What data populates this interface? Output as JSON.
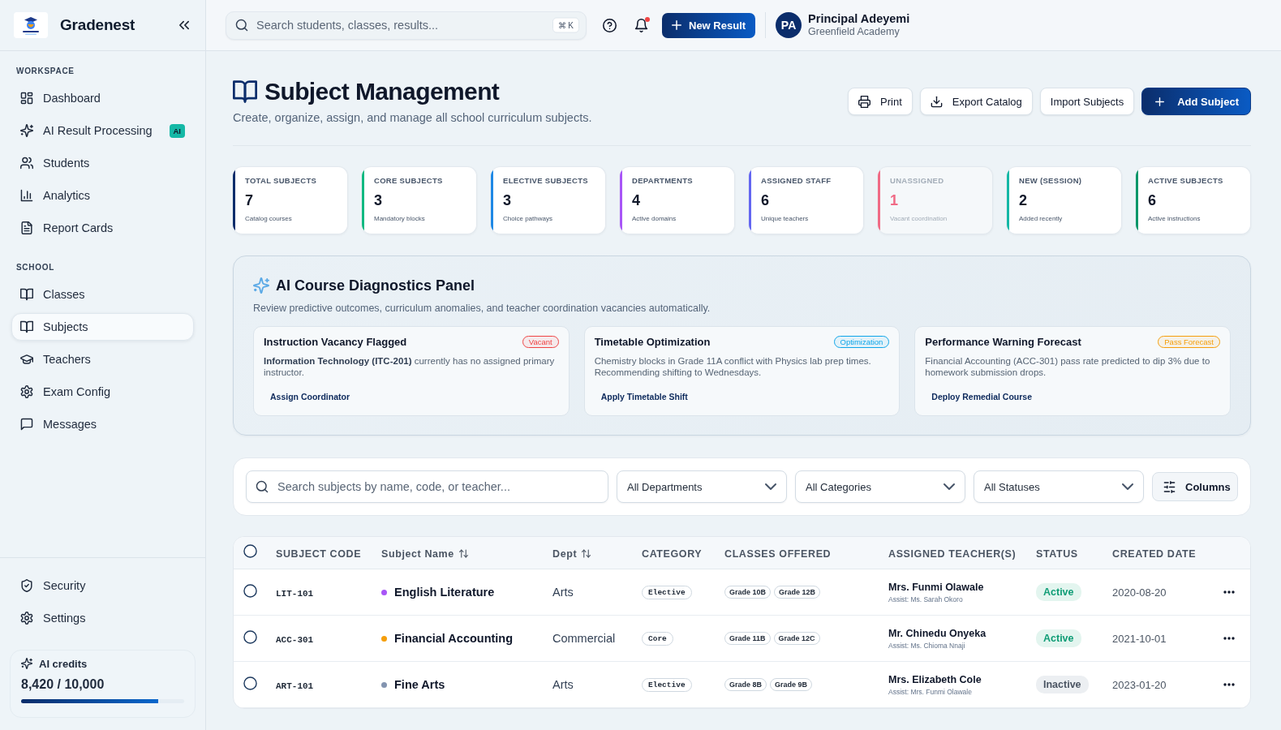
{
  "sidebar": {
    "brand": "Gradenest",
    "sections": [
      {
        "title": "WORKSPACE",
        "items": [
          {
            "label": "Dashboard",
            "selected": false
          },
          {
            "label": "AI Result Processing",
            "selected": false,
            "badge": "AI"
          },
          {
            "label": "Students",
            "selected": false
          },
          {
            "label": "Analytics",
            "selected": false
          },
          {
            "label": "Report Cards",
            "selected": false
          }
        ]
      },
      {
        "title": "SCHOOL",
        "items": [
          {
            "label": "Classes",
            "selected": false
          },
          {
            "label": "Subjects",
            "selected": true
          },
          {
            "label": "Teachers",
            "selected": false
          },
          {
            "label": "Exam Config",
            "selected": false
          },
          {
            "label": "Messages",
            "selected": false
          }
        ]
      }
    ],
    "footer_items": [
      {
        "label": "Security",
        "selected": false
      },
      {
        "label": "Settings",
        "selected": false
      }
    ],
    "credits": {
      "label": "AI credits",
      "value": "8,420 / 10,000",
      "level": 0.842
    }
  },
  "topbar": {
    "search": {
      "placeholder": "Search students, classes, results..."
    },
    "shortcut": "⌘ K",
    "notifications_unread": true,
    "new_button": "New Result",
    "user": {
      "initials": "PA",
      "name": "Principal Adeyemi",
      "school": "Greenfield Academy"
    }
  },
  "page": {
    "title": "Subject Management",
    "subtitle": "Create, organize, assign, and manage all school curriculum subjects.",
    "actions": [
      {
        "label": "Print",
        "kind": "print"
      },
      {
        "label": "Export Catalog",
        "kind": "export"
      },
      {
        "label": "Import Subjects",
        "kind": "import"
      },
      {
        "label": "Add Subject",
        "kind": "add"
      }
    ]
  },
  "stats": [
    {
      "label": "TOTAL SUBJECTS",
      "value": "7",
      "note": "Catalog courses",
      "color": "#0b2d6b",
      "muted": false
    },
    {
      "label": "CORE SUBJECTS",
      "value": "3",
      "note": "Mandatory blocks",
      "color": "#10b981",
      "muted": false
    },
    {
      "label": "ELECTIVE SUBJECTS",
      "value": "3",
      "note": "Choice pathways",
      "color": "#1e88e5",
      "muted": false
    },
    {
      "label": "DEPARTMENTS",
      "value": "4",
      "note": "Active domains",
      "color": "#a855f7",
      "muted": false
    },
    {
      "label": "ASSIGNED STAFF",
      "value": "6",
      "note": "Unique teachers",
      "color": "#6366f1",
      "muted": false
    },
    {
      "label": "UNASSIGNED",
      "value": "1",
      "note": "Vacant coordination",
      "color": "#f06a85",
      "muted": true
    },
    {
      "label": "NEW (SESSION)",
      "value": "2",
      "note": "Added recently",
      "color": "#14b8a6",
      "muted": false
    },
    {
      "label": "ACTIVE SUBJECTS",
      "value": "6",
      "note": "Active instructions",
      "color": "#059669",
      "muted": false
    }
  ],
  "ai_panel": {
    "title": "AI Course Diagnostics Panel",
    "description": "Review predictive outcomes, curriculum anomalies, and teacher coordination vacancies automatically.",
    "insights": [
      {
        "title": "Instruction Vacancy Flagged",
        "tag": "Vacant",
        "color": "#ef4444",
        "text": "**Information Technology (ITC-201)** currently has no assigned primary instructor.",
        "action": "Assign Coordinator"
      },
      {
        "title": "Timetable Optimization",
        "tag": "Optimization",
        "color": "#0ea5e9",
        "text": "Chemistry blocks in Grade 11A conflict with Physics lab prep times. Recommending shifting to Wednesdays.",
        "action": "Apply Timetable Shift"
      },
      {
        "title": "Performance Warning Forecast",
        "tag": "Pass Forecast",
        "color": "#f59e0b",
        "text": "Financial Accounting (ACC-301) pass rate predicted to dip 3% due to homework submission drops.",
        "action": "Deploy Remedial Course"
      }
    ]
  },
  "filters": {
    "search": {
      "placeholder": "Search subjects by name, code, or teacher..."
    },
    "dropdowns": [
      "All Departments",
      "All Categories",
      "All Statuses"
    ],
    "columns_button": "Columns"
  },
  "table": {
    "all_selected": false,
    "columns": [
      {
        "label": "SUBJECT CODE",
        "sortable": false
      },
      {
        "label": "Subject Name",
        "sortable": true
      },
      {
        "label": "Dept",
        "sortable": true
      },
      {
        "label": "CATEGORY",
        "sortable": false
      },
      {
        "label": "CLASSES OFFERED",
        "sortable": false
      },
      {
        "label": "ASSIGNED TEACHER(S)",
        "sortable": false
      },
      {
        "label": "STATUS",
        "sortable": false
      },
      {
        "label": "CREATED DATE",
        "sortable": false
      }
    ],
    "rows": [
      {
        "selected": false,
        "code": "LIT-101",
        "name": "English Literature",
        "color": "#a855f7",
        "dept": "Arts",
        "category": "Elective",
        "classes": [
          "Grade 10B",
          "Grade 12B"
        ],
        "teacher": "Mrs. Funmi Olawale",
        "assistant": "Assist: Ms. Sarah Okoro",
        "status": "Active",
        "active": true,
        "created": "2020-08-20"
      },
      {
        "selected": false,
        "code": "ACC-301",
        "name": "Financial Accounting",
        "color": "#f59e0b",
        "dept": "Commercial",
        "category": "Core",
        "classes": [
          "Grade 11B",
          "Grade 12C"
        ],
        "teacher": "Mr. Chinedu Onyeka",
        "assistant": "Assist: Ms. Chioma Nnaji",
        "status": "Active",
        "active": true,
        "created": "2021-10-01"
      },
      {
        "selected": false,
        "code": "ART-101",
        "name": "Fine Arts",
        "color": "#8394b0",
        "dept": "Arts",
        "category": "Elective",
        "classes": [
          "Grade 8B",
          "Grade 9B"
        ],
        "teacher": "Mrs. Elizabeth Cole",
        "assistant": "Assist: Mrs. Funmi Olawale",
        "status": "Inactive",
        "active": false,
        "created": "2023-01-20"
      }
    ]
  }
}
